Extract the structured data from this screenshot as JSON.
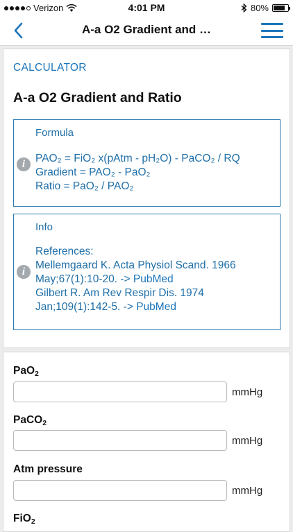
{
  "status_bar": {
    "carrier": "Verizon",
    "time": "4:01 PM",
    "battery_percent": "80%",
    "battery_level": 0.8
  },
  "nav": {
    "title": "A-a O2 Gradient and …",
    "back_icon": "chevron-left-icon",
    "menu_icon": "hamburger-menu-icon",
    "accent_color": "#1b75bb"
  },
  "calculator": {
    "section_label": "CALCULATOR",
    "title": "A-a O2 Gradient and Ratio"
  },
  "formula_box": {
    "header": "Formula",
    "lines": [
      "PAO₂ = FiO₂ x(pAtm - pH₂O) - PaCO₂ / RQ",
      "Gradient = PAO₂ - PaO₂",
      "Ratio = PaO₂ / PAO₂"
    ]
  },
  "info_box": {
    "header": "Info",
    "references_label": "References:",
    "ref1_text": "Mellemgaard K. Acta Physiol Scand. 1966 May;67(1):10-20. ->",
    "ref1_link": "PubMed",
    "ref2_text": "Gilbert R. Am Rev Respir Dis. 1974 Jan;109(1):142-5. ->",
    "ref2_link": "PubMed"
  },
  "fields": [
    {
      "label_main": "PaO",
      "label_sub": "2",
      "value": "",
      "unit": "mmHg"
    },
    {
      "label_main": "PaCO",
      "label_sub": "2",
      "value": "",
      "unit": "mmHg"
    },
    {
      "label_main": "Atm pressure",
      "label_sub": "",
      "value": "",
      "unit": "mmHg"
    },
    {
      "label_main": "FiO",
      "label_sub": "2",
      "value": "",
      "unit": ""
    }
  ]
}
